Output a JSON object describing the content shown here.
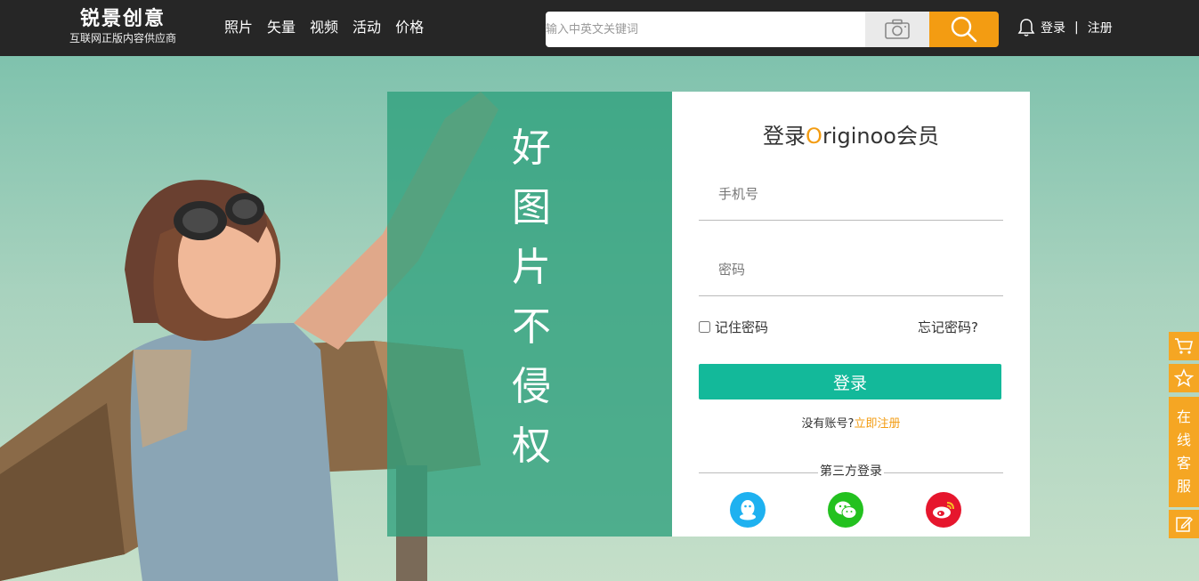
{
  "header": {
    "logo_title": "锐景创意",
    "logo_subtitle": "互联网正版内容供应商",
    "nav": [
      "照片",
      "矢量",
      "视频",
      "活动",
      "价格"
    ],
    "search_placeholder": "输入中英文关键词",
    "login_link": "登录",
    "separator": "|",
    "register_link": "注册"
  },
  "hero": {
    "slogan_chars": [
      "好",
      "图",
      "片",
      "不",
      "侵",
      "权"
    ]
  },
  "login": {
    "title_prefix": "登录",
    "title_accent": "O",
    "title_suffix": "riginoo会员",
    "phone_placeholder": "手机号",
    "password_placeholder": "密码",
    "remember_label": "记住密码",
    "forgot_label": "忘记密码?",
    "submit_label": "登录",
    "no_account_text": "没有账号?",
    "register_now": "立即注册",
    "third_party_label": "第三方登录",
    "third_party": [
      "qq-icon",
      "wechat-icon",
      "weibo-icon"
    ]
  },
  "sidebar": {
    "service_chars": [
      "在",
      "线",
      "客",
      "服"
    ],
    "icons": [
      "cart-icon",
      "star-icon",
      "edit-icon"
    ]
  },
  "colors": {
    "accent_orange": "#f39c12",
    "primary_green": "#13b99a",
    "header_bg": "#262626"
  }
}
